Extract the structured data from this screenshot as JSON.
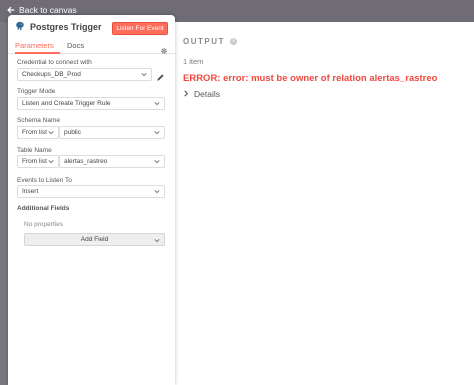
{
  "topbar": {
    "back_label": "Back to canvas"
  },
  "node": {
    "title": "Postgres Trigger",
    "listen_button": "Listen For Event",
    "tabs": [
      {
        "label": "Parameters",
        "active": true
      },
      {
        "label": "Docs",
        "active": false
      }
    ]
  },
  "params": {
    "credential": {
      "label": "Credential to connect with",
      "value": "Checkups_DB_Prod"
    },
    "trigger_mode": {
      "label": "Trigger Mode",
      "value": "Listen and Create Trigger Rule"
    },
    "schema": {
      "label": "Schema Name",
      "mode": "From list",
      "value": "public"
    },
    "table": {
      "label": "Table Name",
      "mode": "From list",
      "value": "alertas_rastreo"
    },
    "events": {
      "label": "Events to Listen To",
      "value": "Insert"
    },
    "additional": {
      "label": "Additional Fields",
      "empty_text": "No properties",
      "add_button": "Add Field"
    }
  },
  "output": {
    "title": "OUTPUT",
    "items": "1 item",
    "error": "ERROR: error: must be owner of relation alertas_rastreo",
    "details": "Details"
  },
  "colors": {
    "accent": "#ff6d5a",
    "error": "#f0483e",
    "canvas": "#7a7780"
  }
}
